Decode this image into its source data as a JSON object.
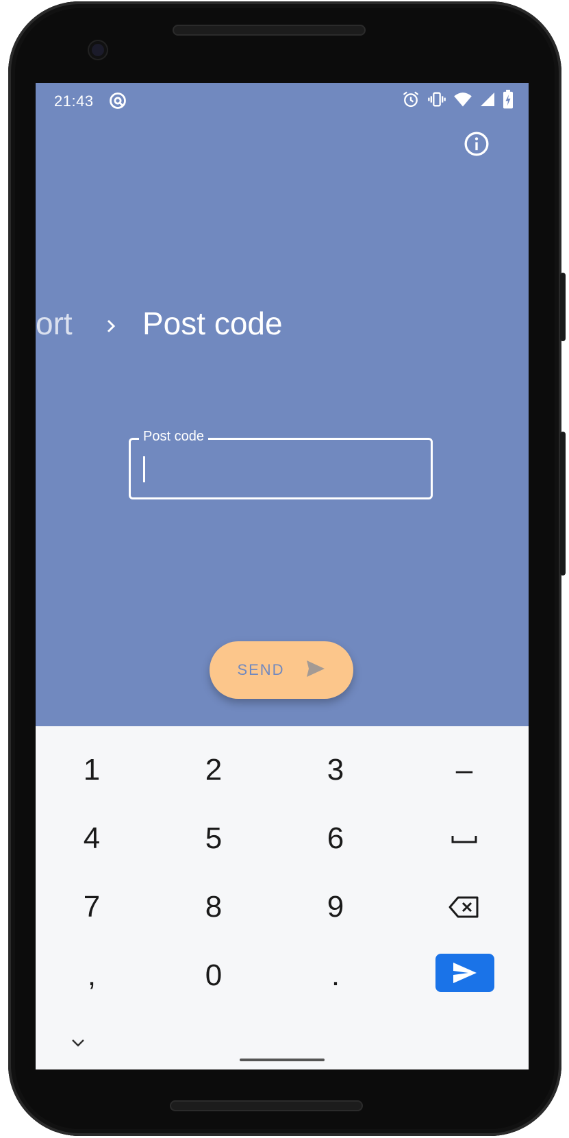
{
  "status_bar": {
    "time": "21:43",
    "icons": [
      "at-sign-icon",
      "alarm-icon",
      "vibrate-icon",
      "wifi-icon",
      "signal-icon",
      "battery-charging-icon"
    ]
  },
  "app_bar": {
    "icon": "info-icon"
  },
  "breadcrumb": {
    "previous": "ort",
    "separator_icon": "chevron-right-icon",
    "current": "Post code"
  },
  "post_code_field": {
    "label": "Post code",
    "value": "",
    "placeholder": ""
  },
  "send_button": {
    "label": "SEND",
    "icon": "send-arrow-icon"
  },
  "keyboard": {
    "keys": [
      "1",
      "2",
      "3",
      "–",
      "4",
      "5",
      "6",
      "␣",
      "7",
      "8",
      "9",
      "backspace",
      ",",
      "0",
      ".",
      "enter"
    ],
    "collapse_icon": "chevron-down-icon"
  },
  "colors": {
    "background": "#7189bf",
    "send_button": "#fcc68b",
    "keyboard": "#f6f7f9",
    "enter_key": "#1a73e8"
  }
}
